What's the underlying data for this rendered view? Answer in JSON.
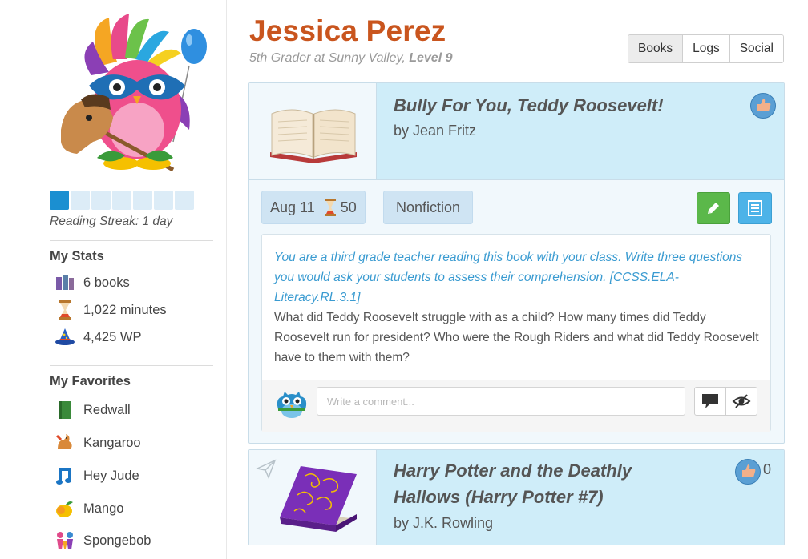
{
  "student": {
    "name": "Jessica Perez",
    "subtitle_prefix": "5th Grader at Sunny Valley, ",
    "level": "Level 9"
  },
  "tabs": [
    {
      "label": "Books",
      "active": true
    },
    {
      "label": "Logs",
      "active": false
    },
    {
      "label": "Social",
      "active": false
    }
  ],
  "sidebar": {
    "streak": {
      "filled": 1,
      "total": 7,
      "label": "Reading Streak: 1 day"
    },
    "stats_title": "My Stats",
    "stats": [
      {
        "icon": "books-icon",
        "value": "6 books"
      },
      {
        "icon": "hourglass-icon",
        "value": "1,022 minutes"
      },
      {
        "icon": "wizard-hat-icon",
        "value": "4,425 WP"
      }
    ],
    "favorites_title": "My Favorites",
    "favorites": [
      {
        "icon": "green-book-icon",
        "label": "Redwall"
      },
      {
        "icon": "kangaroo-icon",
        "label": "Kangaroo"
      },
      {
        "icon": "music-note-icon",
        "label": "Hey Jude"
      },
      {
        "icon": "mango-icon",
        "label": "Mango"
      },
      {
        "icon": "spongebob-icon",
        "label": "Spongebob"
      }
    ]
  },
  "books": [
    {
      "title": "Bully For You, Teddy Roosevelt!",
      "author": "by Jean Fritz",
      "date": "Aug 11",
      "minutes": "50",
      "genre": "Nonfiction",
      "prompt": "You are a third grade teacher reading this book with your class. Write three questions you would ask your students to assess their comprehension. [CCSS.ELA-Literacy.RL.3.1]",
      "answer": "What did Teddy Roosevelt struggle with as a child? How many times did Teddy Roosevelt run for president? Who were the Rough Riders and what did Teddy Roosevelt have to them with them?",
      "comment_placeholder": "Write a comment..."
    },
    {
      "title_line1": "Harry Potter and the Deathly",
      "title_line2": "Hallows (Harry Potter #7)",
      "author": "by J.K. Rowling",
      "likes": "0"
    }
  ],
  "colors": {
    "name": "#c9551e",
    "accent_blue": "#1b8fd1",
    "card_info_bg": "#cfedf9",
    "edit_green": "#5bb84a",
    "log_blue": "#4db3e8",
    "prompt_text": "#3a9bd1"
  }
}
